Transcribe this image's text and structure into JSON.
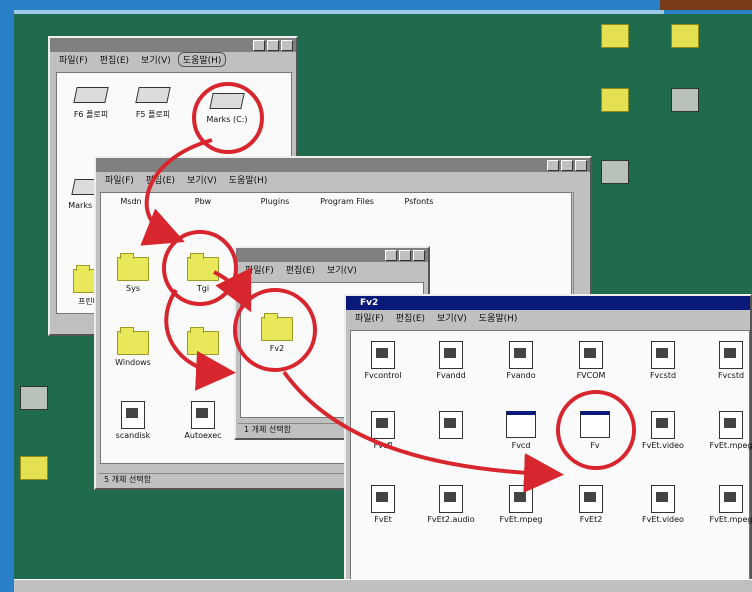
{
  "desktop_icons": [
    {
      "label": "",
      "icon": "folder-icon"
    },
    {
      "label": "",
      "icon": "folder-icon"
    },
    {
      "label": "",
      "icon": "folder-icon"
    },
    {
      "label": "",
      "icon": "document-icon"
    },
    {
      "label": "",
      "icon": "program-icon"
    }
  ],
  "window1": {
    "menu": [
      "파일(F)",
      "편집(E)",
      "보기(V)",
      "도움말(H)"
    ],
    "items": [
      {
        "label": "F6 플로피",
        "icon": "floppy-drive-icon"
      },
      {
        "label": "F5 플로피",
        "icon": "floppy-drive-icon"
      },
      {
        "label": "Marks (C:)",
        "icon": "hard-drive-icon"
      },
      {
        "label": "Marks (D:)",
        "icon": "hard-drive-icon"
      },
      {
        "label": "프린터",
        "icon": "folder-icon"
      }
    ]
  },
  "window2": {
    "menu": [
      "파일(F)",
      "편집(E)",
      "보기(V)",
      "도움말(H)"
    ],
    "row_labels": [
      "Msdn",
      "Pbw",
      "Plugins",
      "Program Files",
      "Psfonts"
    ],
    "items": [
      {
        "label": "Sys",
        "icon": "folder-icon"
      },
      {
        "label": "Tgi",
        "icon": "folder-icon"
      },
      {
        "label": "Windows",
        "icon": "folder-icon"
      },
      {
        "label": "",
        "icon": "folder-icon"
      },
      {
        "label": "scandisk",
        "icon": "document-icon"
      },
      {
        "label": "Autoexec",
        "icon": "document-icon"
      }
    ],
    "status": "5 개체 선택함"
  },
  "window3": {
    "menu": [
      "파일(F)",
      "편집(E)",
      "보기(V)"
    ],
    "items": [
      {
        "label": "Fv2",
        "icon": "folder-icon"
      }
    ],
    "status": "1 개체 선택함"
  },
  "window4": {
    "title": "Fv2",
    "menu": [
      "파일(F)",
      "편집(E)",
      "보기(V)",
      "도움말(H)"
    ],
    "items": [
      {
        "label": "Fvcontrol",
        "icon": "document-icon"
      },
      {
        "label": "Fvandd",
        "icon": "document-icon"
      },
      {
        "label": "Fvando",
        "icon": "document-icon"
      },
      {
        "label": "FVCOM",
        "icon": "document-icon"
      },
      {
        "label": "Fvcstd",
        "icon": "document-icon"
      },
      {
        "label": "Fvcstd",
        "icon": "document-icon"
      },
      {
        "label": "Fvcfl",
        "icon": "document-icon"
      },
      {
        "label": "",
        "icon": "document-icon"
      },
      {
        "label": "Fvcd",
        "icon": "program-icon"
      },
      {
        "label": "Fv",
        "icon": "program-icon"
      },
      {
        "label": "FvEt.video",
        "icon": "document-icon"
      },
      {
        "label": "FvEt.mpeg",
        "icon": "document-icon"
      },
      {
        "label": "FvEt",
        "icon": "document-icon"
      },
      {
        "label": "FvEt2.audio",
        "icon": "document-icon"
      },
      {
        "label": "FvEt.mpeg",
        "icon": "document-icon"
      },
      {
        "label": "FvEt2",
        "icon": "document-icon"
      },
      {
        "label": "FvEt.video",
        "icon": "document-icon"
      },
      {
        "label": "FvEt.mpeg",
        "icon": "document-icon"
      }
    ]
  },
  "colors": {
    "desktop": "#1f6b4c",
    "frame": "#2a7fc9",
    "annotation": "#d8262e",
    "title_active": "#0a1a7a"
  }
}
